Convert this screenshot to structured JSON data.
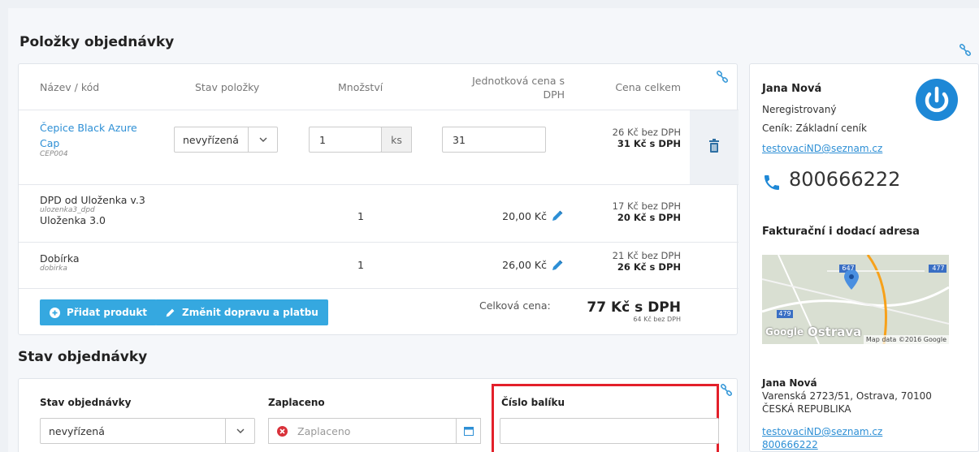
{
  "items_section": {
    "title": "Položky objednávky",
    "columns": {
      "name": "Název / kód",
      "state": "Stav položky",
      "qty": "Množství",
      "unit_price": "Jednotková cena s DPH",
      "total": "Cena celkem"
    },
    "product": {
      "name": "Čepice Black Azure Cap",
      "code": "CEP004",
      "state": "nevyřízená",
      "qty": "1",
      "unit": "ks",
      "unit_price": "31",
      "total_net": "26 Kč bez DPH",
      "total_gross": "31 Kč s DPH"
    },
    "shipping": {
      "name": "DPD od Uloženka v.3",
      "code": "ulozenka3_dpd",
      "subname": "Uloženka 3.0",
      "qty": "1",
      "unit_price": "20,00 Kč",
      "total_net": "17 Kč bez DPH",
      "total_gross": "20 Kč s DPH"
    },
    "payment": {
      "name": "Dobírka",
      "code": "dobirka",
      "qty": "1",
      "unit_price": "26,00 Kč",
      "total_net": "21 Kč bez DPH",
      "total_gross": "26 Kč s DPH"
    },
    "buttons": {
      "add_product": "Přidat produkt",
      "change_shipping": "Změnit dopravu a platbu"
    },
    "summary": {
      "label": "Celková cena:",
      "gross": "77 Kč s DPH",
      "net": "64 Kč bez DPH"
    }
  },
  "state_section": {
    "title": "Stav objednávky",
    "order_state_label": "Stav objednávky",
    "order_state_value": "nevyřízená",
    "paid_label": "Zaplaceno",
    "paid_placeholder": "Zaplaceno",
    "package_label": "Číslo balíku",
    "package_value": ""
  },
  "customer": {
    "name": "Jana Nová",
    "status": "Neregistrovaný",
    "pricelist": "Ceník: Základní ceník",
    "email": "testovaciND@seznam.cz",
    "phone": "800666222",
    "address_title": "Fakturační i dodací adresa",
    "map": {
      "badge1": "647",
      "badge2": "477",
      "badge3": "479",
      "google": "Google",
      "city": "Ostrava",
      "credit": "Map data ©2016 Google"
    },
    "addr_name": "Jana Nová",
    "addr_street": "Varenská 2723/51, Ostrava, 70100",
    "addr_country": "ČESKÁ REPUBLIKA",
    "addr_email": "testovaciND@seznam.cz",
    "addr_phone": "800666222"
  },
  "colors": {
    "accent": "#35a8e0",
    "link": "#2d8fd5",
    "highlight": "#e3202a"
  }
}
